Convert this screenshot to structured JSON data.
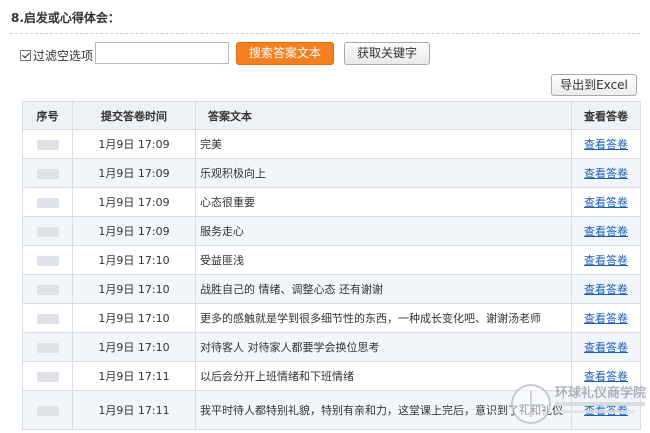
{
  "question": {
    "title": "8.启发或心得体会："
  },
  "filter": {
    "checkbox_label": "过滤空选项",
    "checked": true
  },
  "search": {
    "value": "",
    "placeholder": ""
  },
  "buttons": {
    "search": "搜索答案文本",
    "keywords": "获取关键字",
    "export": "导出到Excel"
  },
  "table": {
    "headers": {
      "no": "序号",
      "time": "提交答卷时间",
      "text": "答案文本",
      "view": "查看答卷"
    },
    "rows": [
      {
        "time": "1月9日 17:09",
        "text": "完美",
        "view": "查看答卷"
      },
      {
        "time": "1月9日 17:09",
        "text": "乐观积极向上",
        "view": "查看答卷"
      },
      {
        "time": "1月9日 17:09",
        "text": "心态很重要",
        "view": "查看答卷"
      },
      {
        "time": "1月9日 17:09",
        "text": "服务走心",
        "view": "查看答卷"
      },
      {
        "time": "1月9日 17:10",
        "text": "受益匪浅",
        "view": "查看答卷"
      },
      {
        "time": "1月9日 17:10",
        "text": "战胜自己的 情绪、调整心态 还有谢谢",
        "view": "查看答卷"
      },
      {
        "time": "1月9日 17:10",
        "text": "更多的感触就是学到很多细节性的东西，一种成长变化吧、谢谢汤老师",
        "view": "查看答卷"
      },
      {
        "time": "1月9日 17:10",
        "text": "对待客人 对待家人都要学会换位思考",
        "view": "查看答卷"
      },
      {
        "time": "1月9日 17:11",
        "text": "以后会分开上班情绪和下班情绪",
        "view": "查看答卷"
      },
      {
        "time": "1月9日 17:11",
        "text": "我平时待人都特别礼貌，特别有亲和力，这堂课上完后，意识到了礼和礼仪",
        "view": "查看答卷"
      }
    ]
  },
  "watermark": {
    "text": "环球礼仪商学院"
  }
}
